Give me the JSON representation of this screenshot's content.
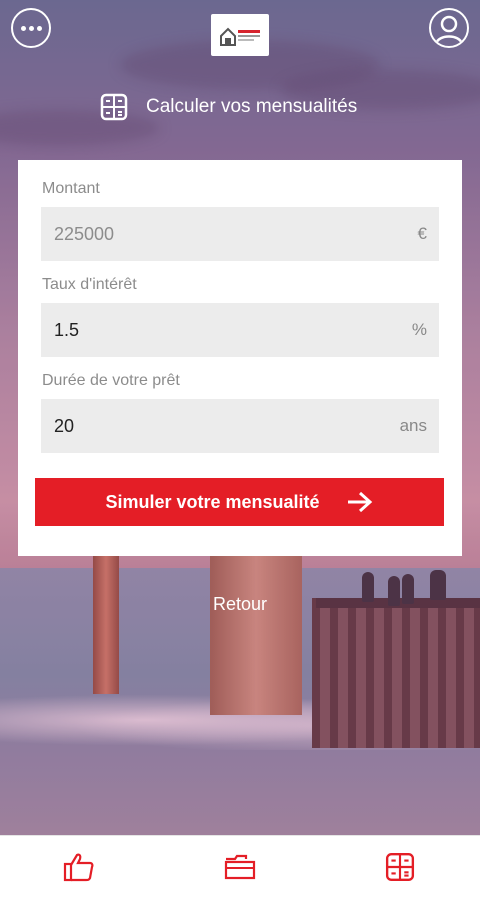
{
  "header": {
    "menu_icon": "more-dots-icon",
    "profile_icon": "user-profile-icon",
    "logo_icon": "real-estate-logo"
  },
  "title": {
    "icon": "calculator-icon",
    "text": "Calculer vos mensualités"
  },
  "form": {
    "montant": {
      "label": "Montant",
      "value": "225000",
      "unit": "€"
    },
    "taux": {
      "label": "Taux d'intérêt",
      "value": "1.5",
      "unit": "%"
    },
    "duree": {
      "label": "Durée de votre prêt",
      "value": "20",
      "unit": "ans"
    }
  },
  "simulate_button": {
    "label": "Simuler votre mensualité",
    "icon": "arrow-right-icon"
  },
  "back_link": "Retour",
  "tabbar": {
    "items": [
      {
        "icon": "thumbs-up-icon"
      },
      {
        "icon": "folder-icon"
      },
      {
        "icon": "calculator-icon"
      }
    ]
  },
  "colors": {
    "accent": "#e41e26",
    "field_bg": "#ececec"
  }
}
